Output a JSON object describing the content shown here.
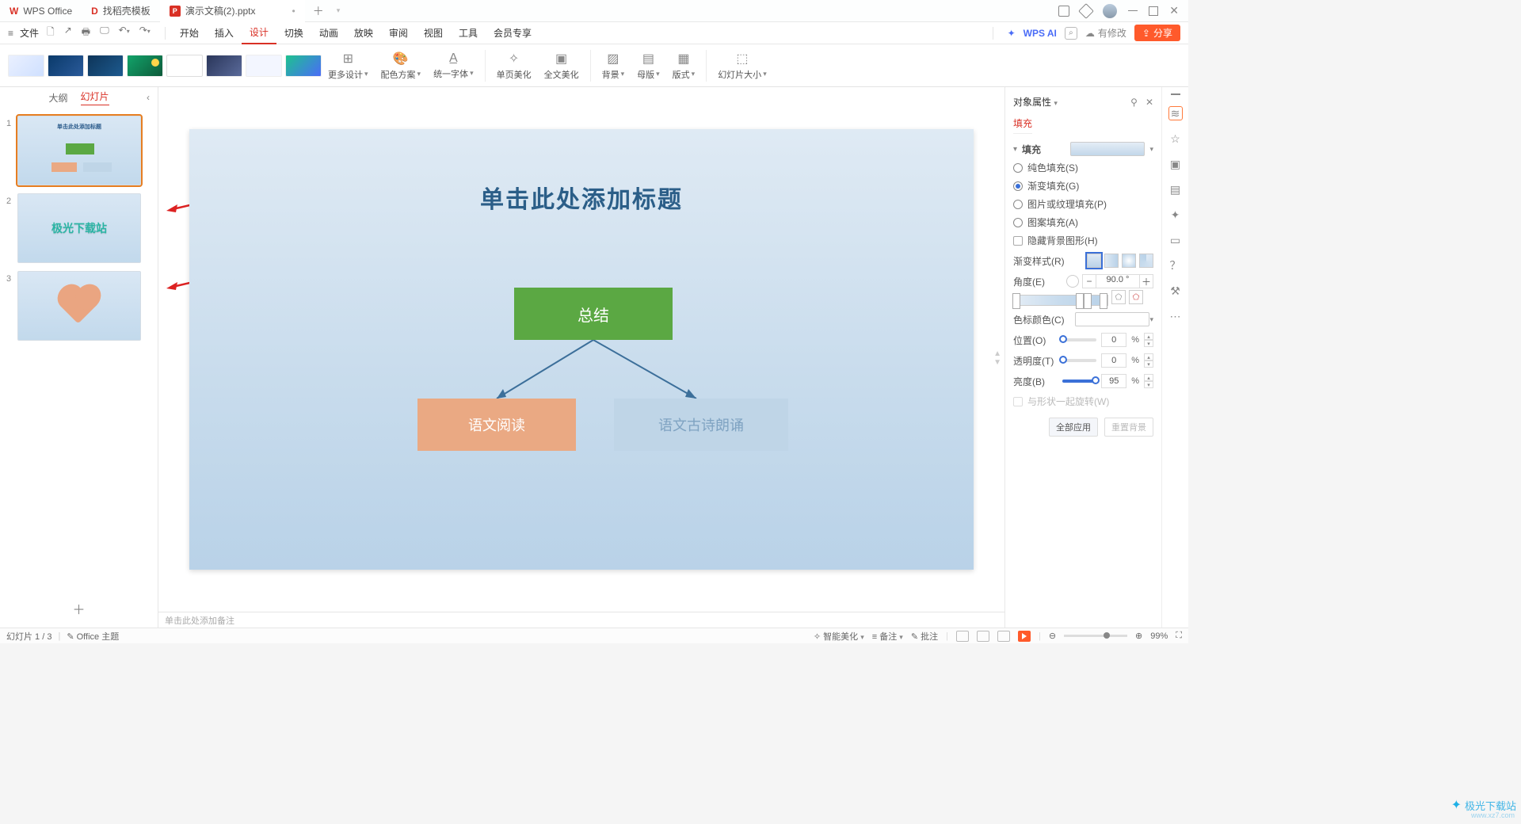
{
  "tabs": {
    "wps": "WPS Office",
    "doker": "找稻壳模板",
    "file": "演示文稿(2).pptx"
  },
  "menubar": {
    "file": "文件",
    "items": [
      "开始",
      "插入",
      "设计",
      "切换",
      "动画",
      "放映",
      "审阅",
      "视图",
      "工具",
      "会员专享"
    ],
    "active_index": 2,
    "wps_ai": "WPS AI",
    "cloud_status": "有修改",
    "share": "分享"
  },
  "ribbon": {
    "more_design": "更多设计",
    "color_scheme": "配色方案",
    "unify_font": "统一字体",
    "page_beautify": "单页美化",
    "full_beautify": "全文美化",
    "background": "背景",
    "master": "母版",
    "layout": "版式",
    "slide_size": "幻灯片大小"
  },
  "left_panel": {
    "tab_outline": "大纲",
    "tab_slides": "幻灯片",
    "slides": [
      {
        "num": "1"
      },
      {
        "num": "2",
        "text": "极光下载站"
      },
      {
        "num": "3"
      }
    ]
  },
  "slide": {
    "title": "单击此处添加标题",
    "summary": "总结",
    "box2": "语文阅读",
    "box3": "语文古诗朗诵"
  },
  "notes_placeholder": "单击此处添加备注",
  "right_panel": {
    "header": "对象属性",
    "sub_tab": "填充",
    "section_label": "填充",
    "radios": {
      "solid": "纯色填充(S)",
      "gradient": "渐变填充(G)",
      "picture": "图片或纹理填充(P)",
      "pattern": "图案填充(A)"
    },
    "hide_bg_shapes": "隐藏背景图形(H)",
    "gradient_style": "渐变样式(R)",
    "angle": "角度(E)",
    "angle_value": "90.0",
    "angle_unit": "°",
    "stop_color": "色标颜色(C)",
    "position": "位置(O)",
    "position_value": "0",
    "transparency": "透明度(T)",
    "transparency_value": "0",
    "brightness": "亮度(B)",
    "brightness_value": "95",
    "percent": "%",
    "rotate_with_shape": "与形状一起旋转(W)",
    "apply_all": "全部应用",
    "reset_bg": "重置背景"
  },
  "status": {
    "slide_pos": "幻灯片 1 / 3",
    "theme": "Office 主题",
    "smart_beautify": "智能美化",
    "notes_btn": "备注",
    "comments_btn": "批注",
    "zoom": "99%"
  },
  "watermark": {
    "brand": "极光下载站",
    "url": "www.xz7.com"
  }
}
